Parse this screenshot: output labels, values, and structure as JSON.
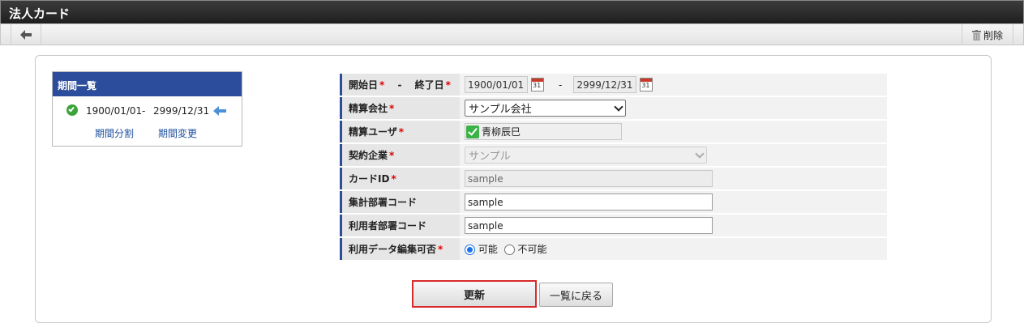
{
  "window": {
    "title": "法人カード"
  },
  "toolbar": {
    "back_icon": "arrow-left-icon",
    "delete_label": "削除",
    "delete_icon": "trash-icon"
  },
  "period_list": {
    "title": "期間一覧",
    "period": {
      "start": "1900/01/01",
      "separator": "-",
      "end": "2999/12/31"
    },
    "split_link": "期間分割",
    "change_link": "期間変更"
  },
  "form": {
    "dates": {
      "start_label": "開始日",
      "separator": "-",
      "end_label": "終了日",
      "required": "*",
      "start_value": "1900/01/01",
      "end_value": "2999/12/31",
      "range_separator": "-",
      "calendar_text": "31"
    },
    "company": {
      "label": "精算会社",
      "required": "*",
      "value": "サンプル会社"
    },
    "user": {
      "label": "精算ユーザ",
      "required": "*",
      "value": "青柳辰巳"
    },
    "contractor": {
      "label": "契約企業",
      "required": "*",
      "value": "サンプル"
    },
    "card_id": {
      "label": "カードID",
      "required": "*",
      "value": "sample"
    },
    "aggregate_dept": {
      "label": "集計部署コード",
      "value": "sample"
    },
    "user_dept": {
      "label": "利用者部署コード",
      "value": "sample"
    },
    "editable": {
      "label": "利用データ編集可否",
      "required": "*",
      "option_yes": "可能",
      "option_no": "不可能",
      "selected": "可能"
    }
  },
  "actions": {
    "update_label": "更新",
    "back_label": "一覧に戻る"
  },
  "colors": {
    "accent": "#2b4d9b",
    "required": "#dd0000",
    "highlight": "#d72b2b"
  }
}
